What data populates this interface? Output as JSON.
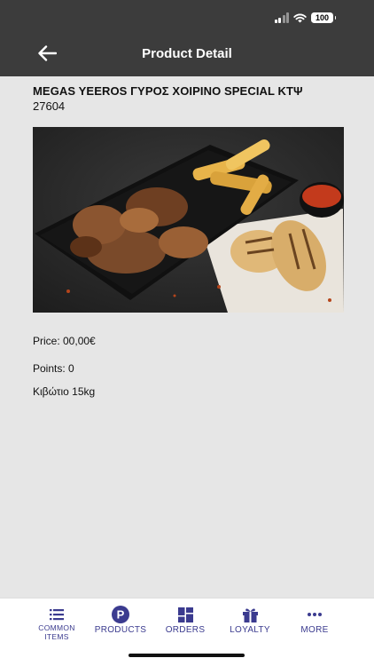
{
  "status": {
    "battery": "100"
  },
  "header": {
    "title": "Product Detail"
  },
  "product": {
    "name": "MEGAS YEEROS ΓΥΡΟΣ ΧΟΙΡΙΝΟ SPECIAL ΚΤΨ",
    "code": "27604",
    "image_alt": "product-photo",
    "price": "Price: 00,00€",
    "points": "Points: 0",
    "package": "Κιβώτιο 15kg"
  },
  "tabs": [
    {
      "label": "COMMON ITEMS",
      "icon": "list-icon"
    },
    {
      "label": "PRODUCTS",
      "icon": "p-circle-icon"
    },
    {
      "label": "ORDERS",
      "icon": "grid-icon"
    },
    {
      "label": "LOYALTY",
      "icon": "gift-icon"
    },
    {
      "label": "MORE",
      "icon": "more-dots-icon"
    }
  ],
  "colors": {
    "header_bg": "#3c3c3c",
    "page_bg": "#e6e6e6",
    "tab_accent": "#3b3b8f"
  }
}
